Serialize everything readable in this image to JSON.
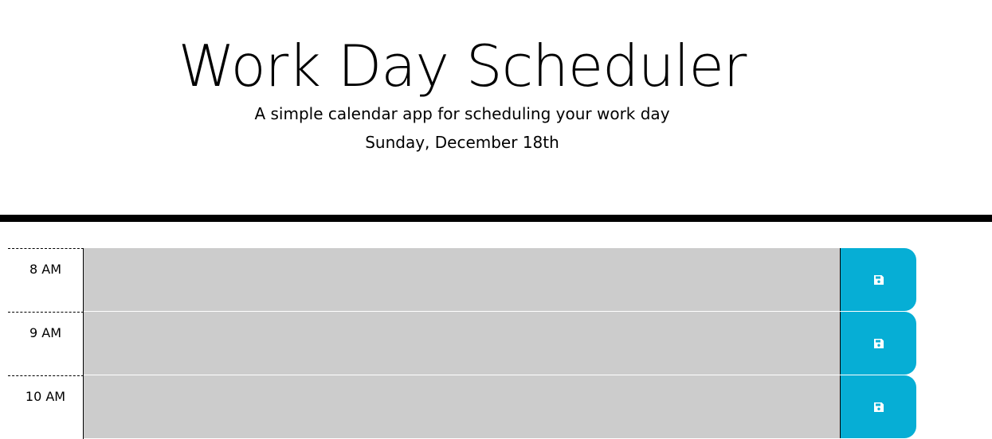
{
  "header": {
    "title": "Work Day Scheduler",
    "subtitle": "A simple calendar app for scheduling your work day",
    "current_day": "Sunday, December 18th"
  },
  "schedule": {
    "rows": [
      {
        "hour": "8 AM",
        "description": "",
        "save_icon": "floppy-disk-icon"
      },
      {
        "hour": "9 AM",
        "description": "",
        "save_icon": "floppy-disk-icon"
      },
      {
        "hour": "10 AM",
        "description": "",
        "save_icon": "floppy-disk-icon"
      }
    ]
  },
  "colors": {
    "past": "#cccccc",
    "save_button": "#06aed5",
    "divider": "#000000"
  }
}
